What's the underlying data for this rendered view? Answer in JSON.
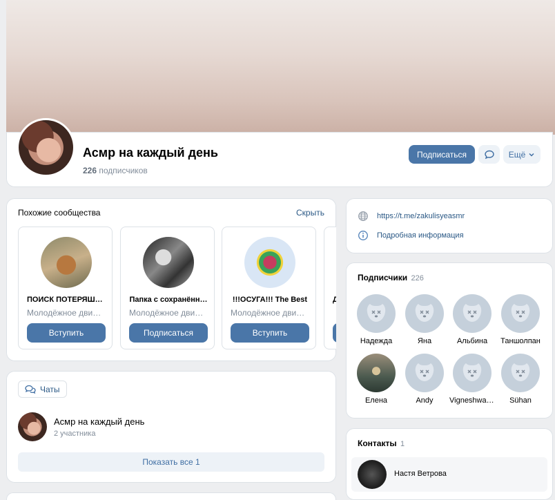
{
  "group": {
    "title": "Асмр на каждый день",
    "subscribers_count": "226",
    "subscribers_word": "подписчиков",
    "subscribe_label": "Подписаться",
    "more_label": "Ещё"
  },
  "similar": {
    "title": "Похожие сообщества",
    "hide_label": "Скрыть",
    "items": [
      {
        "name": "ПОИСК ПОТЕРЯШЕ…",
        "desc": "Молодёжное движ…",
        "button": "Вступить"
      },
      {
        "name": "Папка с сохранённ…",
        "desc": "Молодёжное движ…",
        "button": "Подписаться"
      },
      {
        "name": "!!!ОСУГА!!! The Best",
        "desc": "Молодёжное движ…",
        "button": "Вступить"
      },
      {
        "name": "Д",
        "desc": "",
        "button": ""
      }
    ]
  },
  "chats": {
    "tab_label": "Чаты",
    "chat_title": "Асмр на каждый день",
    "chat_members": "2 участника",
    "show_all": "Показать все 1"
  },
  "links": {
    "telegram": "https://t.me/zakulisyeasmr",
    "details": "Подробная информация"
  },
  "followers": {
    "title": "Подписчики",
    "count": "226",
    "items": [
      "Надежда",
      "Яна",
      "Альбина",
      "Таншолпан",
      "Елена",
      "Andy",
      "Vigneshwar…",
      "Sühan"
    ]
  },
  "contacts": {
    "title": "Контакты",
    "count": "1",
    "name": "Настя Ветрова"
  }
}
